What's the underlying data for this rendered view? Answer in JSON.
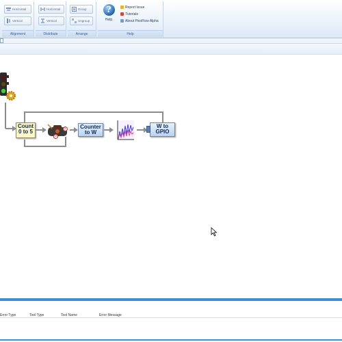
{
  "ribbon": {
    "alignment": {
      "label": "Alignment",
      "horizontal": "Horizontal",
      "vertical": "Vertical"
    },
    "distribute": {
      "label": "Distribute",
      "horizontal": "Horizontal",
      "vertical": "Vertical"
    },
    "arrange": {
      "label": "Arrange",
      "group": "Group",
      "ungroup": "Ungroup"
    },
    "help": {
      "label": "Help",
      "button_label": "Help",
      "links": [
        "Report Issue",
        "Tutorials",
        "About PicoFlow Alpha"
      ]
    }
  },
  "flow": {
    "count_block": "Count 0 to 5",
    "counter_block": "Counter to W",
    "gpio_block": "W to GPIO",
    "badge_a": "5",
    "badge_b": "5"
  },
  "error_panel": {
    "columns": [
      "Error Type",
      "Tool Type",
      "Tool Name",
      "Error Message"
    ]
  },
  "colors": {
    "accent": "#3d8fd8",
    "ribbon_text": "#1e395b",
    "block_yellow": "#fdf7c6",
    "block_blue": "#cfe2f7"
  }
}
